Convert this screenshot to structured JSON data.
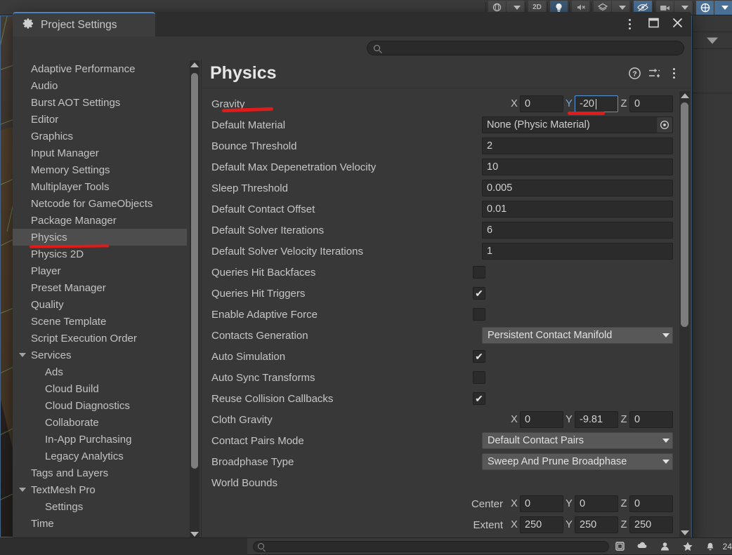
{
  "unity_toolbar": {
    "buttons": [
      {
        "name": "pivot-rotation-dropdown",
        "label": "",
        "icon": "globe-icon",
        "state": "normal"
      },
      {
        "name": "toggle-2d-button",
        "label": "2D",
        "icon": "2d-icon",
        "state": "normal"
      },
      {
        "name": "toggle-lighting-button",
        "label": "",
        "icon": "lightbulb-icon",
        "state": "active"
      },
      {
        "name": "toggle-audio-button",
        "label": "",
        "icon": "audio-mute-icon",
        "state": "normal"
      },
      {
        "name": "fx-dropdown-button",
        "label": "",
        "icon": "layers-icon",
        "state": "normal"
      },
      {
        "name": "scene-visibility-button",
        "label": "",
        "icon": "eye-off-icon",
        "state": "active"
      },
      {
        "name": "camera-settings-button",
        "label": "",
        "icon": "camera-icon",
        "state": "normal"
      },
      {
        "name": "gizmos-button",
        "label": "",
        "icon": "gizmo-globe-icon",
        "state": "active"
      }
    ]
  },
  "window": {
    "tab_label": "Project Settings",
    "tab_icon": "gear-icon",
    "controls": [
      {
        "name": "window-menu-button",
        "icon": "kebab-menu-icon"
      },
      {
        "name": "window-maximize-button",
        "icon": "maximize-icon"
      },
      {
        "name": "window-close-button",
        "icon": "close-icon"
      }
    ]
  },
  "search": {
    "value": "",
    "placeholder": "",
    "icon": "search-icon"
  },
  "sidebar": {
    "items": [
      {
        "label": "Adaptive Performance",
        "indent": 0,
        "twisty": false,
        "selected": false
      },
      {
        "label": "Audio",
        "indent": 0,
        "twisty": false,
        "selected": false
      },
      {
        "label": "Burst AOT Settings",
        "indent": 0,
        "twisty": false,
        "selected": false
      },
      {
        "label": "Editor",
        "indent": 0,
        "twisty": false,
        "selected": false
      },
      {
        "label": "Graphics",
        "indent": 0,
        "twisty": false,
        "selected": false
      },
      {
        "label": "Input Manager",
        "indent": 0,
        "twisty": false,
        "selected": false
      },
      {
        "label": "Memory Settings",
        "indent": 0,
        "twisty": false,
        "selected": false
      },
      {
        "label": "Multiplayer Tools",
        "indent": 0,
        "twisty": false,
        "selected": false
      },
      {
        "label": "Netcode for GameObjects",
        "indent": 0,
        "twisty": false,
        "selected": false
      },
      {
        "label": "Package Manager",
        "indent": 0,
        "twisty": false,
        "selected": false
      },
      {
        "label": "Physics",
        "indent": 0,
        "twisty": false,
        "selected": true
      },
      {
        "label": "Physics 2D",
        "indent": 0,
        "twisty": false,
        "selected": false
      },
      {
        "label": "Player",
        "indent": 0,
        "twisty": false,
        "selected": false
      },
      {
        "label": "Preset Manager",
        "indent": 0,
        "twisty": false,
        "selected": false
      },
      {
        "label": "Quality",
        "indent": 0,
        "twisty": false,
        "selected": false
      },
      {
        "label": "Scene Template",
        "indent": 0,
        "twisty": false,
        "selected": false
      },
      {
        "label": "Script Execution Order",
        "indent": 0,
        "twisty": false,
        "selected": false
      },
      {
        "label": "Services",
        "indent": 0,
        "twisty": true,
        "selected": false
      },
      {
        "label": "Ads",
        "indent": 1,
        "twisty": false,
        "selected": false
      },
      {
        "label": "Cloud Build",
        "indent": 1,
        "twisty": false,
        "selected": false
      },
      {
        "label": "Cloud Diagnostics",
        "indent": 1,
        "twisty": false,
        "selected": false
      },
      {
        "label": "Collaborate",
        "indent": 1,
        "twisty": false,
        "selected": false
      },
      {
        "label": "In-App Purchasing",
        "indent": 1,
        "twisty": false,
        "selected": false
      },
      {
        "label": "Legacy Analytics",
        "indent": 1,
        "twisty": false,
        "selected": false
      },
      {
        "label": "Tags and Layers",
        "indent": 0,
        "twisty": false,
        "selected": false
      },
      {
        "label": "TextMesh Pro",
        "indent": 0,
        "twisty": true,
        "selected": false
      },
      {
        "label": "Settings",
        "indent": 1,
        "twisty": false,
        "selected": false
      },
      {
        "label": "Time",
        "indent": 0,
        "twisty": false,
        "selected": false
      }
    ]
  },
  "main": {
    "title": "Physics",
    "header_icons": [
      {
        "name": "help-icon",
        "label": "?"
      },
      {
        "name": "preset-icon",
        "label": ""
      },
      {
        "name": "kebab-menu-icon",
        "label": ""
      }
    ],
    "fields": [
      {
        "name": "gravity",
        "label": "Gravity",
        "type": "vector3",
        "axes": [
          {
            "axis": "X",
            "value": "0",
            "focused": false
          },
          {
            "axis": "Y",
            "value": "-20",
            "focused": true
          },
          {
            "axis": "Z",
            "value": "0",
            "focused": false
          }
        ]
      },
      {
        "name": "default-material",
        "label": "Default Material",
        "type": "object",
        "value": "None (Physic Material)"
      },
      {
        "name": "bounce-threshold",
        "label": "Bounce Threshold",
        "type": "text",
        "value": "2"
      },
      {
        "name": "default-max-depenetration-velocity",
        "label": "Default Max Depenetration Velocity",
        "type": "text",
        "value": "10"
      },
      {
        "name": "sleep-threshold",
        "label": "Sleep Threshold",
        "type": "text",
        "value": "0.005"
      },
      {
        "name": "default-contact-offset",
        "label": "Default Contact Offset",
        "type": "text",
        "value": "0.01"
      },
      {
        "name": "default-solver-iterations",
        "label": "Default Solver Iterations",
        "type": "text",
        "value": "6"
      },
      {
        "name": "default-solver-velocity-iterations",
        "label": "Default Solver Velocity Iterations",
        "type": "text",
        "value": "1"
      },
      {
        "name": "queries-hit-backfaces",
        "label": "Queries Hit Backfaces",
        "type": "checkbox",
        "checked": false
      },
      {
        "name": "queries-hit-triggers",
        "label": "Queries Hit Triggers",
        "type": "checkbox",
        "checked": true
      },
      {
        "name": "enable-adaptive-force",
        "label": "Enable Adaptive Force",
        "type": "checkbox",
        "checked": false
      },
      {
        "name": "contacts-generation",
        "label": "Contacts Generation",
        "type": "dropdown",
        "value": "Persistent Contact Manifold"
      },
      {
        "name": "auto-simulation",
        "label": "Auto Simulation",
        "type": "checkbox",
        "checked": true
      },
      {
        "name": "auto-sync-transforms",
        "label": "Auto Sync Transforms",
        "type": "checkbox",
        "checked": false
      },
      {
        "name": "reuse-collision-callbacks",
        "label": "Reuse Collision Callbacks",
        "type": "checkbox",
        "checked": true
      },
      {
        "name": "cloth-gravity",
        "label": "Cloth Gravity",
        "type": "vector3",
        "axes": [
          {
            "axis": "X",
            "value": "0",
            "focused": false
          },
          {
            "axis": "Y",
            "value": "-9.81",
            "focused": false
          },
          {
            "axis": "Z",
            "value": "0",
            "focused": false
          }
        ]
      },
      {
        "name": "contact-pairs-mode",
        "label": "Contact Pairs Mode",
        "type": "dropdown",
        "value": "Default Contact Pairs"
      },
      {
        "name": "broadphase-type",
        "label": "Broadphase Type",
        "type": "dropdown",
        "value": "Sweep And Prune Broadphase"
      },
      {
        "name": "world-bounds",
        "label": "World Bounds",
        "type": "header"
      },
      {
        "name": "world-bounds-center",
        "label": "",
        "sublabel": "Center",
        "type": "vector3-sub",
        "axes": [
          {
            "axis": "X",
            "value": "0",
            "focused": false
          },
          {
            "axis": "Y",
            "value": "0",
            "focused": false
          },
          {
            "axis": "Z",
            "value": "0",
            "focused": false
          }
        ]
      },
      {
        "name": "world-bounds-extent",
        "label": "",
        "sublabel": "Extent",
        "type": "vector3-sub",
        "axes": [
          {
            "axis": "X",
            "value": "250",
            "focused": false
          },
          {
            "axis": "Y",
            "value": "250",
            "focused": false
          },
          {
            "axis": "Z",
            "value": "250",
            "focused": false
          }
        ]
      }
    ]
  },
  "bottom_bar": {
    "search_value": "",
    "search_icon": "search-icon",
    "buttons": [
      {
        "name": "save-layout-button",
        "icon": "window-icon"
      },
      {
        "name": "collab-button",
        "icon": "cloud-icon"
      },
      {
        "name": "account-button",
        "icon": "person-icon"
      },
      {
        "name": "favorite-button",
        "icon": "star-icon"
      },
      {
        "name": "notification-button",
        "icon": "bell-icon"
      }
    ],
    "count_label": "24"
  },
  "annotations": [
    {
      "name": "physics-underline-annotation",
      "color": "#e01b1b",
      "target": "sidebar-item-physics"
    },
    {
      "name": "gravity-underline-annotation",
      "color": "#e01b1b",
      "target": "gravity-label"
    },
    {
      "name": "gravity-y-underline-annotation",
      "color": "#e01b1b",
      "target": "gravity-y-input"
    }
  ],
  "colors": {
    "accent_tab": "#4b83c4",
    "focus_border": "#5a93d4",
    "annotation_red": "#e01b1b",
    "panel_bg": "#383838",
    "field_bg": "#2b2b2b",
    "dropdown_bg": "#585858"
  }
}
